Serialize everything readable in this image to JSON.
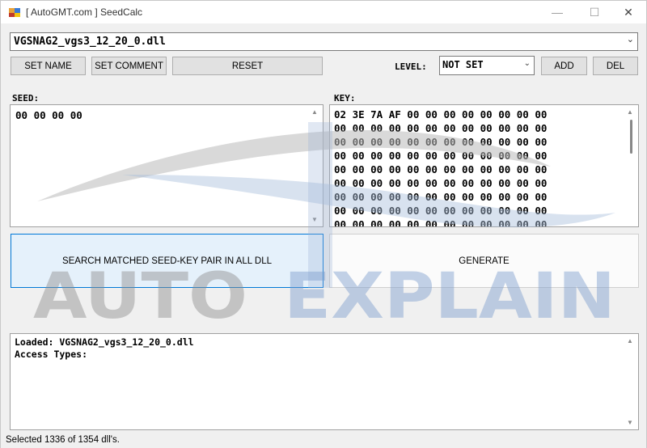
{
  "window": {
    "title": "[ AutoGMT.com ] SeedCalc",
    "minimize_icon": "—",
    "maximize_icon": "☐",
    "close_icon": "✕"
  },
  "dll_select": {
    "value": "VGSNAG2_vgs3_12_20_0.dll",
    "arrow": "⌄"
  },
  "toolbar": {
    "set_name": "SET NAME",
    "set_comment": "SET COMMENT",
    "reset": "RESET",
    "level_label": "LEVEL:",
    "level_value": "NOT SET",
    "level_arrow": "⌄",
    "add": "ADD",
    "del": "DEL"
  },
  "seed": {
    "label": "SEED:",
    "value": "00 00 00 00"
  },
  "key": {
    "label": "KEY:",
    "value": "02 3E 7A AF 00 00 00 00 00 00 00 00\n00 00 00 00 00 00 00 00 00 00 00 00\n00 00 00 00 00 00 00 00 00 00 00 00\n00 00 00 00 00 00 00 00 00 00 00 00\n00 00 00 00 00 00 00 00 00 00 00 00\n00 00 00 00 00 00 00 00 00 00 00 00\n00 00 00 00 00 00 00 00 00 00 00 00\n00 00 00 00 00 00 00 00 00 00 00 00\n00 00 00 00 00 00 00 00 00 00 00 00"
  },
  "actions": {
    "search": "SEARCH MATCHED SEED-KEY PAIR IN ALL DLL",
    "generate": "GENERATE"
  },
  "log": {
    "text": "Loaded: VGSNAG2_vgs3_12_20_0.dll\nAccess Types:"
  },
  "status": {
    "text": "Selected 1336 of 1354 dll's."
  },
  "watermark": {
    "word1": "AUTO",
    "word2": "EXPLAIN"
  },
  "colors": {
    "accent_border": "#0078d7",
    "accent_fill": "#e5f1fb",
    "watermark_grey": "#8c8c8c",
    "watermark_blue": "#7b9ccc"
  }
}
